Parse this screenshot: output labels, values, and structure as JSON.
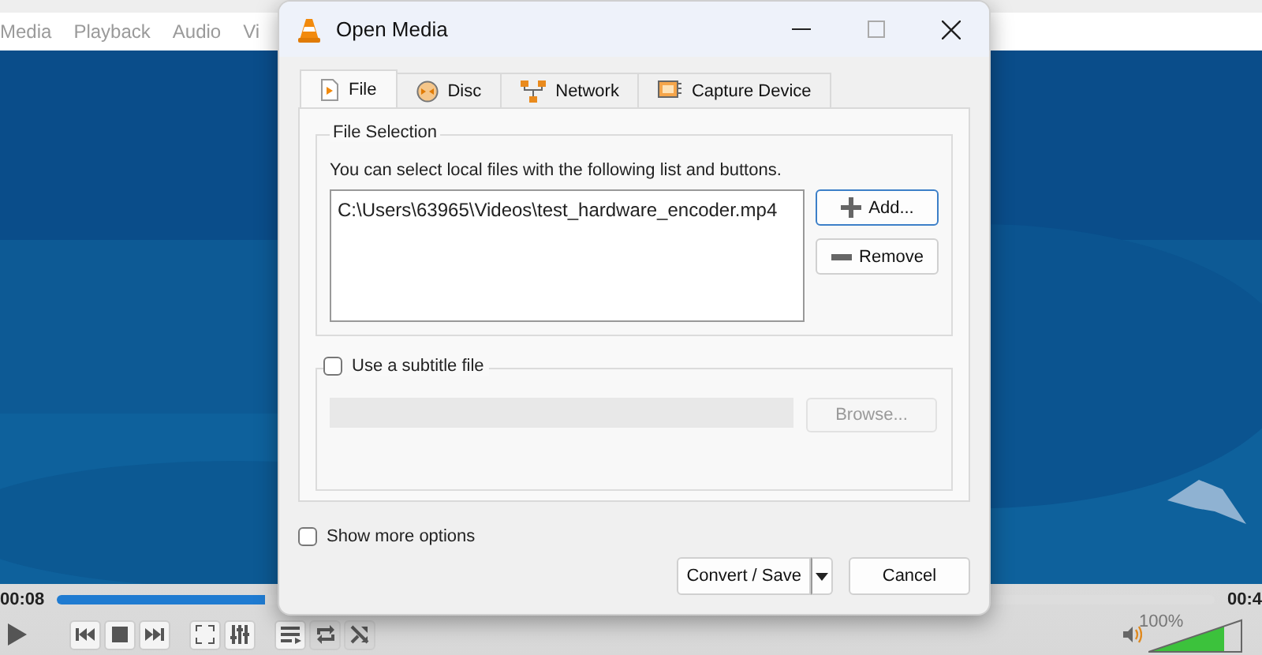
{
  "player": {
    "menu": [
      "Media",
      "Playback",
      "Audio",
      "Vi"
    ],
    "elapsed": "00:08",
    "total": "00:4",
    "seek": {
      "level": 0.18
    },
    "controls": [
      {
        "kind": "play"
      },
      {
        "kind": "previous"
      },
      {
        "kind": "stop"
      },
      {
        "kind": "next"
      },
      {
        "kind": "fullscreen"
      },
      {
        "kind": "settings"
      },
      {
        "kind": "playlist"
      },
      {
        "kind": "loop"
      },
      {
        "kind": "shuffle"
      }
    ],
    "volume": {
      "reading": "100%",
      "level": 0.8
    }
  },
  "dialog": {
    "title": "Open Media",
    "tabs": [
      {
        "label": "File",
        "kind": "file",
        "selected": true
      },
      {
        "label": "Disc",
        "kind": "disc",
        "selected": false
      },
      {
        "label": "Network",
        "kind": "network",
        "selected": false
      },
      {
        "label": "Capture Device",
        "kind": "capture",
        "selected": false
      }
    ],
    "file_selection": {
      "title": "File Selection",
      "hint": "You can select local files with the following list and buttons.",
      "files": [
        "C:\\Users\\63965\\Videos\\test_hardware_encoder.mp4"
      ],
      "buttons": [
        {
          "label": "Add...",
          "kind": "add"
        },
        {
          "label": "Remove",
          "kind": "remove"
        }
      ]
    },
    "subtitle": {
      "label": "Use a subtitle file",
      "checked": false,
      "browse": {
        "label": "Browse...",
        "disabled": true
      }
    },
    "show_more": {
      "label": "Show more options",
      "checked": false
    },
    "buttons": [
      {
        "label": "Convert / Save",
        "kind": "split"
      },
      {
        "label": "Cancel",
        "kind": "plain"
      }
    ]
  }
}
